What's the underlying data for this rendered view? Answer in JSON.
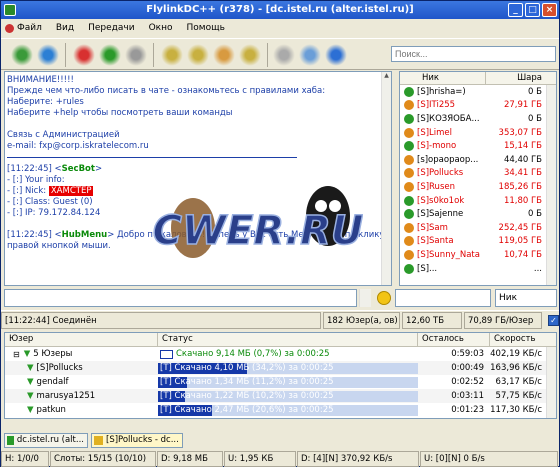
{
  "window": {
    "title": "FlylinkDC++ (r378) - [dc.istel.ru (alter.istel.ru)]",
    "min": "_",
    "max": "□",
    "close": "×"
  },
  "menu": [
    "Файл",
    "Вид",
    "Передачи",
    "Окно",
    "Помощь"
  ],
  "search": {
    "placeholder": "Поиск..."
  },
  "chat": {
    "lines": [
      "ВНИМАНИЕ!!!!!",
      "Прежде чем что-либо писать в чате - ознакомьтесь с правилами хаба:",
      "Наберите: +rules",
      "Наберите +help чтобы посмотреть ваши команды",
      "",
      "Связь с Администрацией",
      "e-mail: fxp@corp.iskratelecom.ru"
    ],
    "bot_time": "[11:22:45] <",
    "bot_name": "SecBot",
    "bot_end": ">",
    "info": [
      "- [:] Your info:",
      "- [:] Nick: ",
      "- [:] Class: Guest (0)",
      "- [:] IP: 79.172.84.124"
    ],
    "nick": "ХАМСТЕР",
    "menu_time": "[11:22:45] <",
    "menu_name": "HubMenu",
    "menu_msg": "> Добро пожаловать! Теперь у Вас есть Меню_Хаба по клику",
    "menu_msg2": "правой кнопкой мыши.",
    "logo": "CWER.RU"
  },
  "users": {
    "col_nick": "Ник",
    "col_share": "Шара",
    "rows": [
      {
        "nick": "[S]hrisha=)",
        "share": "0 Б",
        "color": "#000000",
        "icon": "#2a9a2a"
      },
      {
        "nick": "[S]ITi255",
        "share": "27,91 ГБ",
        "color": "#e00000",
        "icon": "#e08a1a"
      },
      {
        "nick": "[S]КОЗЯОБА...",
        "share": "0 Б",
        "color": "#000000",
        "icon": "#2a9a2a"
      },
      {
        "nick": "[S]Limel",
        "share": "353,07 ГБ",
        "color": "#e00000",
        "icon": "#e08a1a"
      },
      {
        "nick": "[S]-mono",
        "share": "15,14 ГБ",
        "color": "#e00000",
        "icon": "#2a9a2a"
      },
      {
        "nick": "[s]opaopaop...",
        "share": "44,40 ГБ",
        "color": "#000000",
        "icon": "#e08a1a"
      },
      {
        "nick": "[S]Pollucks",
        "share": "34,41 ГБ",
        "color": "#e00000",
        "icon": "#e08a1a"
      },
      {
        "nick": "[S]Rusen",
        "share": "185,26 ГБ",
        "color": "#e00000",
        "icon": "#e08a1a"
      },
      {
        "nick": "[S]s0ko1ok",
        "share": "11,80 ГБ",
        "color": "#e00000",
        "icon": "#2a9a2a"
      },
      {
        "nick": "[S]Sajenne",
        "share": "0 Б",
        "color": "#000000",
        "icon": "#2a9a2a"
      },
      {
        "nick": "[S]Sam",
        "share": "252,45 ГБ",
        "color": "#e00000",
        "icon": "#e08a1a"
      },
      {
        "nick": "[S]Santa",
        "share": "119,05 ГБ",
        "color": "#e00000",
        "icon": "#e08a1a"
      },
      {
        "nick": "[S]Sunny_Nata",
        "share": "10,74 ГБ",
        "color": "#e00000",
        "icon": "#e08a1a"
      },
      {
        "nick": "[S]...",
        "share": "...",
        "color": "#000000",
        "icon": "#2a9a2a"
      }
    ]
  },
  "filter": {
    "select": "Ник"
  },
  "status1": {
    "time_status": "[11:22:44] Соединён",
    "users": "182 Юзер(а, ов)",
    "share": "12,60 ТБ",
    "per_user": "70,89 ГБ/Юзер",
    "check": "✓"
  },
  "transfers": {
    "cols": [
      "Юзер",
      "Статус",
      "Осталось",
      "Скорость"
    ],
    "group": {
      "name": "5 Юзеры",
      "status": "Скачано 9,14 МБ (0,7%) за 0:00:25",
      "left": "0:59:03",
      "speed": "402,19 КБ/с"
    },
    "rows": [
      {
        "user": "[S]Pollucks",
        "status": "[T] Скачано 4,10 МБ (34,2%) за 0:00:25",
        "progress": 0.342,
        "left": "0:00:49",
        "speed": "163,96 КБ/с"
      },
      {
        "user": "gendalf",
        "status": "[T] Скачано 1,34 МБ (11,2%) за 0:00:25",
        "progress": 0.112,
        "left": "0:02:52",
        "speed": "63,17 КБ/с"
      },
      {
        "user": "marusya1251",
        "status": "[T] Скачано 1,22 МБ (10,2%) за 0:00:25",
        "progress": 0.102,
        "left": "0:03:11",
        "speed": "57,75 КБ/с"
      },
      {
        "user": "patkun",
        "status": "[T] Скачано 2,47 МБ (20,6%) за 0:00:25",
        "progress": 0.206,
        "left": "0:01:23",
        "speed": "117,30 КБ/с"
      }
    ]
  },
  "tabs": [
    "dc.istel.ru (alt...",
    "[S]Pollucks - dc..."
  ],
  "status2": [
    "Н: 1/0/0",
    "Слоты: 15/15 (10/10)",
    "D: 9,18 МБ",
    "U: 1,95 КБ",
    "D: [4][N] 370,92 КБ/s",
    "U: [0][N] 0 Б/s"
  ]
}
